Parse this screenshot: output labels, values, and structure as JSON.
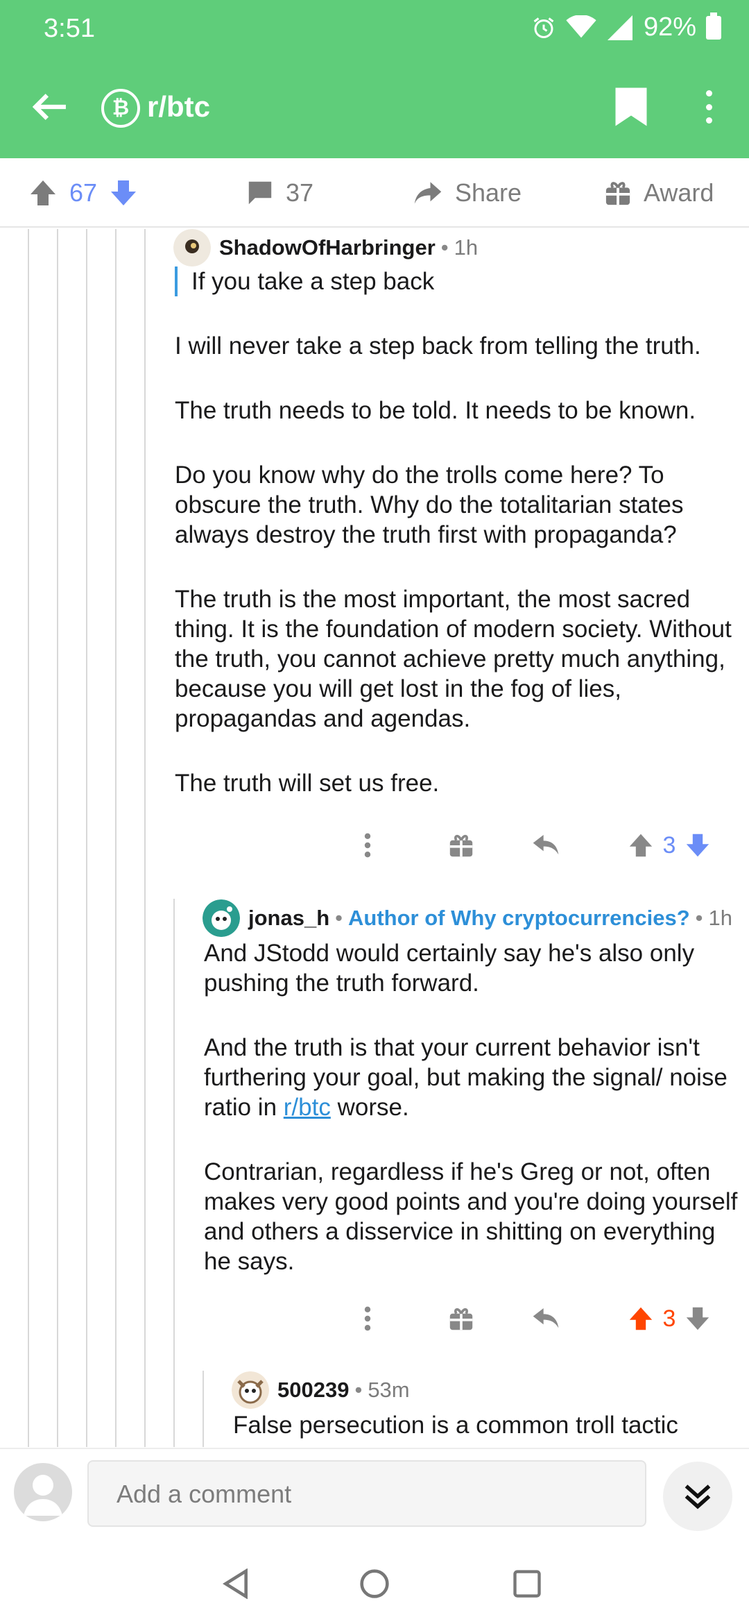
{
  "status_bar": {
    "time": "3:51",
    "battery": "92%"
  },
  "header": {
    "subreddit": "r/btc",
    "sub_icon": "bitcoin-cash-icon"
  },
  "post_actions": {
    "score": "67",
    "comments": "37",
    "share": "Share",
    "award": "Award"
  },
  "colors": {
    "header_green": "#5fcd7a",
    "upvote_blue": "#6b8df7",
    "upvote_orange": "#ff4500",
    "flair_blue": "#2d8fd8"
  },
  "comments": [
    {
      "author": "ShadowOfHarbringer",
      "time": "1h",
      "quote": "If you take a step back",
      "paragraphs": [
        "I will never take a step back from telling the truth.",
        "The truth needs to be told. It needs to be known.",
        "Do you know why do the trolls come here? To obscure the truth. Why do the totalitarian states always destroy the truth first with propaganda?",
        "The truth is the most important, the most sacred thing. It is the foundation of modern society. Without the truth, you cannot achieve pretty much anything, because you will get lost in the fog of lies, propagandas and agendas.",
        "The truth will set us free."
      ],
      "score": "3"
    },
    {
      "author": "jonas_h",
      "flair": "Author of Why cryptocurrencies?",
      "time": "1h",
      "p1": "And JStodd would certainly say he's also only pushing the truth forward.",
      "p2_before": "And the truth is that your current behavior isn't furthering your goal, but making the signal/ noise ratio in ",
      "p2_link": "r/btc",
      "p2_after": " worse.",
      "p3": "Contrarian, regardless if he's Greg or not, often makes very good points and you're doing yourself and others a disservice in shitting on everything he says.",
      "score": "3"
    },
    {
      "author": "500239",
      "time": "53m",
      "p1": "False persecution is a common troll tactic"
    }
  ],
  "composer": {
    "placeholder": "Add a comment"
  }
}
